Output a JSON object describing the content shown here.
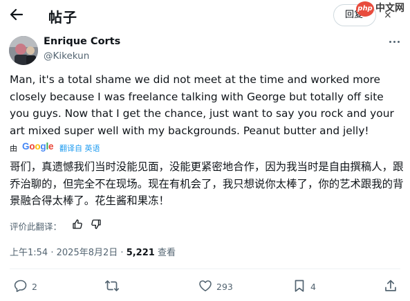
{
  "header": {
    "title": "帖子",
    "reply_label": "回复"
  },
  "watermark": {
    "badge": "php",
    "text": "中文网",
    "x": "×"
  },
  "author": {
    "name": "Enrique Corts",
    "handle": "@Kikekun"
  },
  "tweet": {
    "text": "Man, it's a total shame we did not meet at the time and worked more closely because I was freelance talking with George but totally off site you guys. Now that I get the chance, just want to say you rock and your art mixed super well with my backgrounds. Peanut butter and jelly!"
  },
  "translation": {
    "by_label": "由",
    "provider": "Google",
    "translated_from": "翻译自 英语",
    "text": "哥们，真遗憾我们当时没能见面，没能更紧密地合作，因为我当时是自由撰稿人，跟乔治聊的，但完全不在现场。现在有机会了，我只想说你太棒了，你的艺术跟我的背景融合得太棒了。花生酱和果冻！",
    "rate_label": "评价此翻译："
  },
  "meta": {
    "time": "上午1:54",
    "separator": "·",
    "date": "2025年8月2日",
    "views_count": "5,221",
    "views_label": "查看"
  },
  "actions": {
    "replies": "2",
    "likes": "293",
    "bookmarks": "4"
  },
  "colors": {
    "accent": "#1d9bf0",
    "text": "#0f1419",
    "muted": "#536471"
  },
  "icons": [
    "back-arrow-icon",
    "more-icon",
    "thumb-up-icon",
    "thumb-down-icon",
    "reply-icon",
    "retweet-icon",
    "heart-icon",
    "bookmark-icon",
    "share-icon"
  ]
}
